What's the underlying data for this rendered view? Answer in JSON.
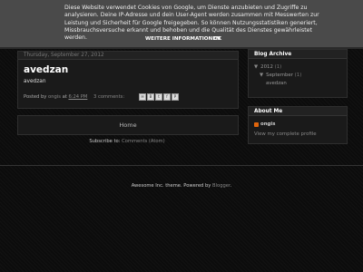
{
  "cookie_notice": {
    "text": "Diese Website verwendet Cookies von Google, um Dienste anzubieten und Zugriffe zu analysieren. Deine IP-Adresse und dein User-Agent werden zusammen mit Messwerten zur Leistung und Sicherheit für Google freigegeben. So können Nutzungsstatistiken generiert, Missbrauchsversuche erkannt und behoben und die Qualität des Dienstes gewährleistet werden.",
    "more_info": "WEITERE INFORMATIONEN",
    "ok": "OK"
  },
  "post": {
    "date": "Thursday, September 27, 2012",
    "title": "avedzan",
    "body": "avedzan",
    "posted_by_prefix": "Posted by",
    "author": "ongis",
    "at_word": "at",
    "time": "6:24 PM",
    "comments": "3 comments:",
    "share_icons": [
      "email-icon",
      "blog-this-icon",
      "twitter-icon",
      "facebook-icon",
      "pinterest-icon"
    ]
  },
  "home_link": "Home",
  "subscribe": {
    "prefix": "Subscribe to:",
    "link": "Comments (Atom)"
  },
  "blog_archive": {
    "title": "Blog Archive",
    "year": "2012",
    "year_count": "(1)",
    "month": "September",
    "month_count": "(1)",
    "post": "avedzan"
  },
  "about_me": {
    "title": "About Me",
    "name": "ongis",
    "profile_link": "View my complete profile"
  },
  "credits": {
    "text": "Awesome Inc. theme. Powered by",
    "link": "Blogger",
    "end": "."
  }
}
